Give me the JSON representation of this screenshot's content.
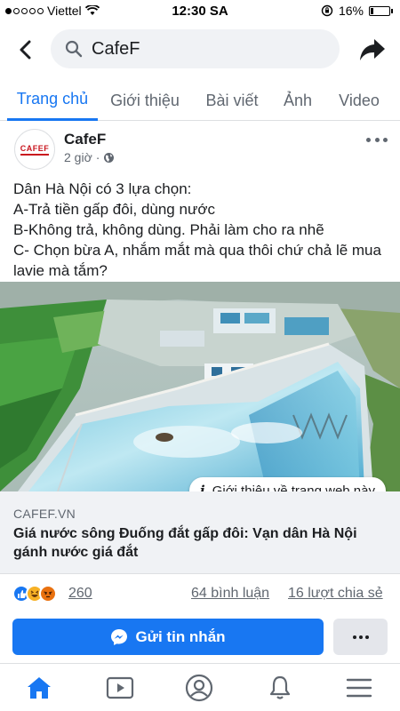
{
  "status_bar": {
    "carrier": "Viettel",
    "time": "12:30 SA",
    "battery": "16%",
    "battery_level": 0.16,
    "signal_bars": 1
  },
  "header": {
    "search_query": "CafeF",
    "icons": [
      "back-arrow-icon",
      "search-icon",
      "share-arrow-icon"
    ]
  },
  "tabs": [
    {
      "label": "Trang chủ",
      "active": true
    },
    {
      "label": "Giới thiệu",
      "active": false
    },
    {
      "label": "Bài viết",
      "active": false
    },
    {
      "label": "Ảnh",
      "active": false
    },
    {
      "label": "Video",
      "active": false
    }
  ],
  "post": {
    "page_name": "CafeF",
    "avatar_text": "CAFEF",
    "time": "2 giờ",
    "separator": "·",
    "text_lines": [
      "Dân Hà Nội có 3 lựa chọn:",
      "A-Trả tiền gấp đôi, dùng nước",
      "B-Không trả, không dùng. Phải làm cho ra nhẽ",
      "C- Chọn bừa A, nhắm mắt mà qua thôi chứ chả lẽ mua lavie mà tắm?"
    ],
    "link_pill": "Giới thiệu về trang web này",
    "link_domain": "CAFEF.VN",
    "link_title": "Giá nước sông Đuống đắt gấp đôi: Vạn dân Hà Nội gánh nước giá đắt"
  },
  "engagement": {
    "reactions": "260",
    "comments": "64 bình luận",
    "shares": "16 lượt chia sẻ",
    "reaction_types": [
      "like-icon",
      "haha-icon",
      "angry-icon"
    ]
  },
  "actions": {
    "message_button": "Gửi tin nhắn"
  },
  "colors": {
    "accent": "#1877f2",
    "text": "#1c1e21",
    "secondary": "#606770",
    "surface": "#f0f2f5"
  },
  "bottom_nav": [
    "home-icon",
    "watch-icon",
    "profile-icon",
    "notifications-icon",
    "menu-icon"
  ]
}
